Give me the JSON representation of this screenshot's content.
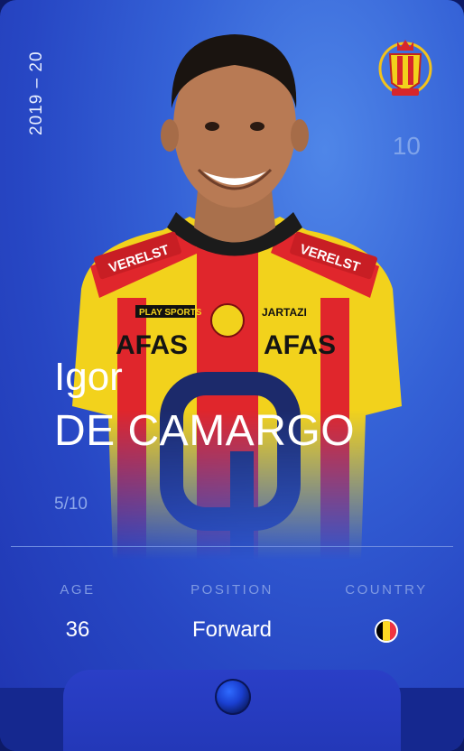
{
  "card": {
    "season": "2019 – 20",
    "serial_number": "10",
    "player_first_name": "Igor",
    "player_last_name": "DE CAMARGO",
    "edition": "5/10",
    "accent_color": "#2747c4",
    "club_badge_icon": "kv-mechelen-crest",
    "rarity_icon": "rare-orb-icon"
  },
  "stats": [
    {
      "label": "AGE",
      "value": "36"
    },
    {
      "label": "POSITION",
      "value": "Forward"
    },
    {
      "label": "COUNTRY",
      "value": "",
      "flag": "belgium-flag",
      "flag_colors": [
        "#000000",
        "#fdda24",
        "#ef3340"
      ]
    }
  ],
  "sponsor_texts": {
    "shirt_sponsor_left": "AFAS",
    "shirt_sponsor_right": "AFAS",
    "shoulder_sponsor": "VERELST",
    "kit_brand": "JARTAZI",
    "chest_small": "PLAY SPORTS"
  }
}
